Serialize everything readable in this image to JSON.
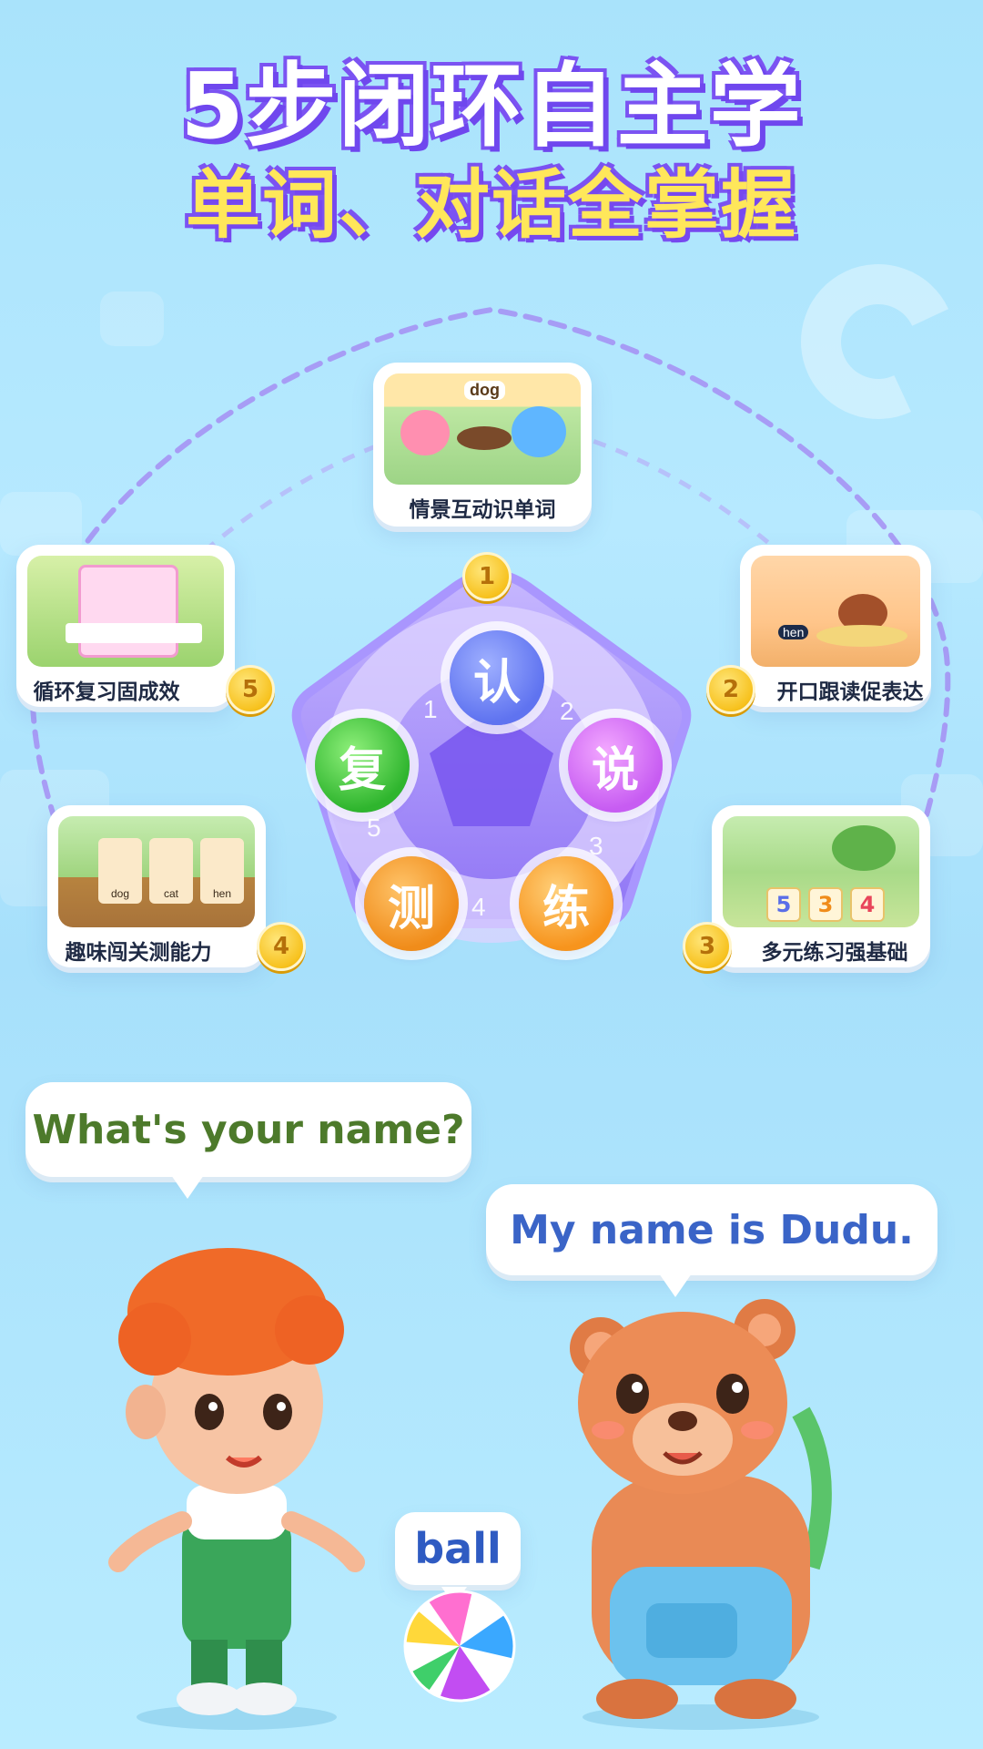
{
  "header": {
    "title": "5步闭环自主学",
    "subtitle": "单词、对话全掌握"
  },
  "steps": [
    {
      "number": "1",
      "caption": "情景互动识单词",
      "thumb_word": "dog"
    },
    {
      "number": "2",
      "caption": "开口跟读促表达",
      "thumb_word": "hen"
    },
    {
      "number": "3",
      "caption": "多元练习强基础",
      "thumb_digits": [
        "5",
        "3",
        "4"
      ]
    },
    {
      "number": "4",
      "caption": "趣味闯关测能力",
      "thumb_words": [
        "dog",
        "cat",
        "hen"
      ]
    },
    {
      "number": "5",
      "caption": "循环复习固成效"
    }
  ],
  "wheel": {
    "balls": [
      "认",
      "说",
      "练",
      "测",
      "复"
    ],
    "inner_numbers": [
      "1",
      "2",
      "3",
      "4",
      "5"
    ]
  },
  "dialogue": {
    "question": "What's your name?",
    "answer": "My name is Dudu.",
    "ball_label": "ball"
  },
  "colors": {
    "title_purple": "#7b53f2",
    "subtitle_yellow": "#ffe75a",
    "question_green": "#4d7a2b",
    "answer_blue": "#3a64c7",
    "ball_label_blue": "#2f5bc2"
  },
  "icons": [
    "pentagon-wheel",
    "gold-number-badge",
    "boy-character",
    "bear-character",
    "beach-ball"
  ]
}
